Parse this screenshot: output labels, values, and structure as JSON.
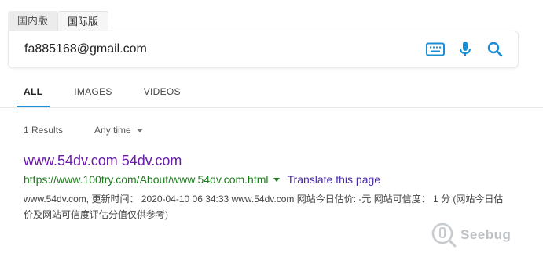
{
  "region_tabs": [
    {
      "label": "国内版"
    },
    {
      "label": "国际版"
    }
  ],
  "search": {
    "value": "fa885168@gmail.com",
    "placeholder": ""
  },
  "icons": {
    "keyboard": "keyboard-icon",
    "microphone": "microphone-icon",
    "search": "search-icon"
  },
  "result_tabs": [
    {
      "label": "ALL"
    },
    {
      "label": "IMAGES"
    },
    {
      "label": "VIDEOS"
    }
  ],
  "results_meta": {
    "count": "1 Results",
    "time_filter": "Any time"
  },
  "result": {
    "title": "www.54dv.com 54dv.com",
    "url": "https://www.100try.com/About/www.54dv.com.html",
    "translate": "Translate this page",
    "snippet": "www.54dv.com, 更新时间： 2020-04-10 06:34:33 www.54dv.com 网站今日估价: -元 网站可信度： 1 分 (网站今日估价及网站可信度评估分值仅供参考)"
  },
  "watermark": {
    "text": "Seebug"
  },
  "colors": {
    "accent": "#1a8fd6",
    "icon": "#1a8fd6",
    "title": "#681da8",
    "url": "#1e7a1e",
    "translate": "#4a2aa8"
  }
}
